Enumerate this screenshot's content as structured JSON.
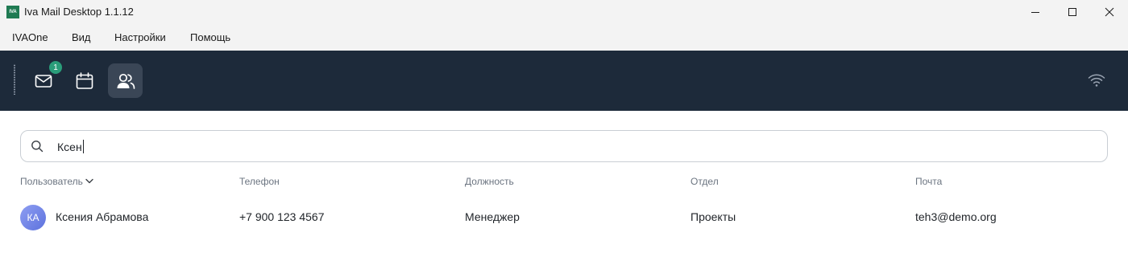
{
  "window": {
    "logo_text": "IVA",
    "title": "Iva Mail Desktop 1.1.12"
  },
  "menu": {
    "items": [
      {
        "label": "IVAOne"
      },
      {
        "label": "Вид"
      },
      {
        "label": "Настройки"
      },
      {
        "label": "Помощь"
      }
    ]
  },
  "toolbar": {
    "buttons": [
      {
        "icon": "mail-icon",
        "badge": "1",
        "active": false
      },
      {
        "icon": "calendar-icon",
        "active": false
      },
      {
        "icon": "contacts-icon",
        "active": true
      }
    ],
    "status_icon": "wifi-icon"
  },
  "search": {
    "value": "Ксен",
    "icon": "search-icon"
  },
  "table": {
    "columns": [
      {
        "label": "Пользователь",
        "sorted": true
      },
      {
        "label": "Телефон"
      },
      {
        "label": "Должность"
      },
      {
        "label": "Отдел"
      },
      {
        "label": "Почта"
      }
    ],
    "rows": [
      {
        "initials": "КА",
        "name": "Ксения Абрамова",
        "phone": "+7 900 123 4567",
        "position": "Менеджер",
        "department": "Проекты",
        "email": "teh3@demo.org"
      }
    ]
  }
}
